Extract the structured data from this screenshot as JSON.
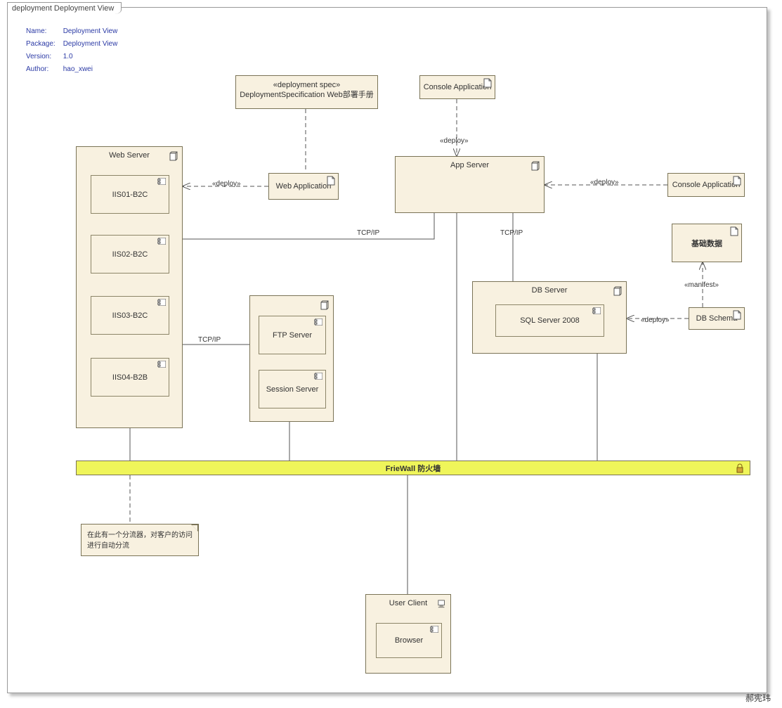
{
  "title_tab": "deployment Deployment View",
  "meta": {
    "labels": {
      "name": "Name:",
      "package": "Package:",
      "version": "Version:",
      "author": "Author:"
    },
    "values": {
      "name": "Deployment View",
      "package": "Deployment View",
      "version": "1.0",
      "author": "hao_xwei"
    }
  },
  "nodes": {
    "webServer": {
      "label": "Web Server",
      "children": {
        "iis01": "IIS01-B2C",
        "iis02": "IIS02-B2C",
        "iis03": "IIS03-B2C",
        "iis04": "IIS04-B2B"
      }
    },
    "appServer": {
      "label": "App Server"
    },
    "ftpGroup": {
      "ftp": "FTP Server",
      "session": "Session Server"
    },
    "dbServer": {
      "label": "DB Server",
      "child": "SQL Server 2008"
    },
    "userClient": {
      "label": "User Client",
      "child": "Browser"
    }
  },
  "artifacts": {
    "deploySpec": {
      "stereo": "«deployment spec»",
      "label": "DeploymentSpecification Web部署手册"
    },
    "consoleApp1": "Console Application",
    "consoleApp2": "Console Application",
    "webApp": "Web Application",
    "baseData": "基础数据",
    "dbSchema": "DB Schema"
  },
  "firewall": "FrieWall 防火墙",
  "note": "在此有一个分流器，对客户的访问进行自动分流",
  "edgeLabels": {
    "deploy": "«deploy»",
    "manifest": "«manifest»",
    "tcpip": "TCP/IP"
  },
  "authorMark": "郝宪玮"
}
